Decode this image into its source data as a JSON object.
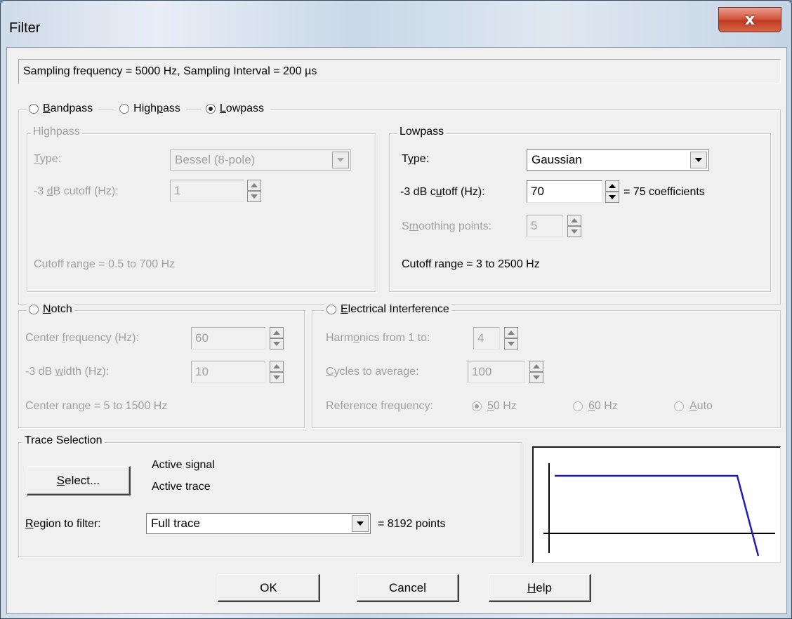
{
  "window": {
    "title": "Filter",
    "close_glyph": "x"
  },
  "info": {
    "sampling": "Sampling frequency = 5000 Hz, Sampling Interval = 200 µs"
  },
  "filter_mode": {
    "bandpass": {
      "pre": "",
      "u": "B",
      "post": "andpass",
      "selected": false
    },
    "highpass": {
      "pre": "High",
      "u": "p",
      "post": "ass",
      "selected": false
    },
    "lowpass": {
      "pre": "",
      "u": "L",
      "post": "owpass",
      "selected": true
    }
  },
  "highpass": {
    "group_label": "Highpass",
    "type_label": {
      "pre": "",
      "u": "T",
      "post": "ype:"
    },
    "type_value": "Bessel (8-pole)",
    "cutoff_label": {
      "pre": "-3 ",
      "u": "d",
      "post": "B cutoff (Hz):"
    },
    "cutoff_value": "1",
    "range": "Cutoff range = 0.5 to 700 Hz"
  },
  "lowpass": {
    "group_label": "Lowpass",
    "type_label": {
      "pre": "T",
      "u": "y",
      "post": "pe:"
    },
    "type_value": "Gaussian",
    "cutoff_label": {
      "pre": "-3 dB c",
      "u": "u",
      "post": "toff (Hz):"
    },
    "cutoff_value": "70",
    "coefficients": "= 75 coefficients",
    "smoothing_label": {
      "pre": "S",
      "u": "m",
      "post": "oothing points:"
    },
    "smoothing_value": "5",
    "range": "Cutoff range = 3 to 2500 Hz"
  },
  "notch": {
    "radio": {
      "pre": "",
      "u": "N",
      "post": "otch",
      "selected": false
    },
    "center_label": {
      "pre": "Center ",
      "u": "f",
      "post": "requency (Hz):"
    },
    "center_value": "60",
    "width_label": {
      "pre": "-3 dB ",
      "u": "w",
      "post": "idth (Hz):"
    },
    "width_value": "10",
    "range": "Center range = 5 to 1500 Hz"
  },
  "interference": {
    "radio": {
      "pre": "",
      "u": "E",
      "post": "lectrical Interference",
      "selected": false
    },
    "harmonics_label": {
      "pre": "Harm",
      "u": "o",
      "post": "nics from 1 to:"
    },
    "harmonics_value": "4",
    "cycles_label": {
      "pre": "",
      "u": "C",
      "post": "ycles to average:"
    },
    "cycles_value": "100",
    "ref_label": "Reference frequency:",
    "ref_50": {
      "pre": "",
      "u": "5",
      "post": "0 Hz",
      "selected": true
    },
    "ref_60": {
      "pre": "",
      "u": "6",
      "post": "0 Hz",
      "selected": false
    },
    "ref_auto": {
      "pre": "",
      "u": "A",
      "post": "uto",
      "selected": false
    }
  },
  "trace": {
    "group_label": "Trace Selection",
    "select_button": {
      "pre": "",
      "u": "S",
      "post": "elect..."
    },
    "active_signal": "Active signal",
    "active_trace": "Active trace",
    "region_label": {
      "pre": "",
      "u": "R",
      "post": "egion to filter:"
    },
    "region_value": "Full trace",
    "points": "= 8192 points"
  },
  "preview": {
    "line_color": "#1f1fb8",
    "axis_color": "#000000"
  },
  "buttons": {
    "ok": "OK",
    "cancel": "Cancel",
    "help": {
      "pre": "",
      "u": "H",
      "post": "elp"
    }
  }
}
